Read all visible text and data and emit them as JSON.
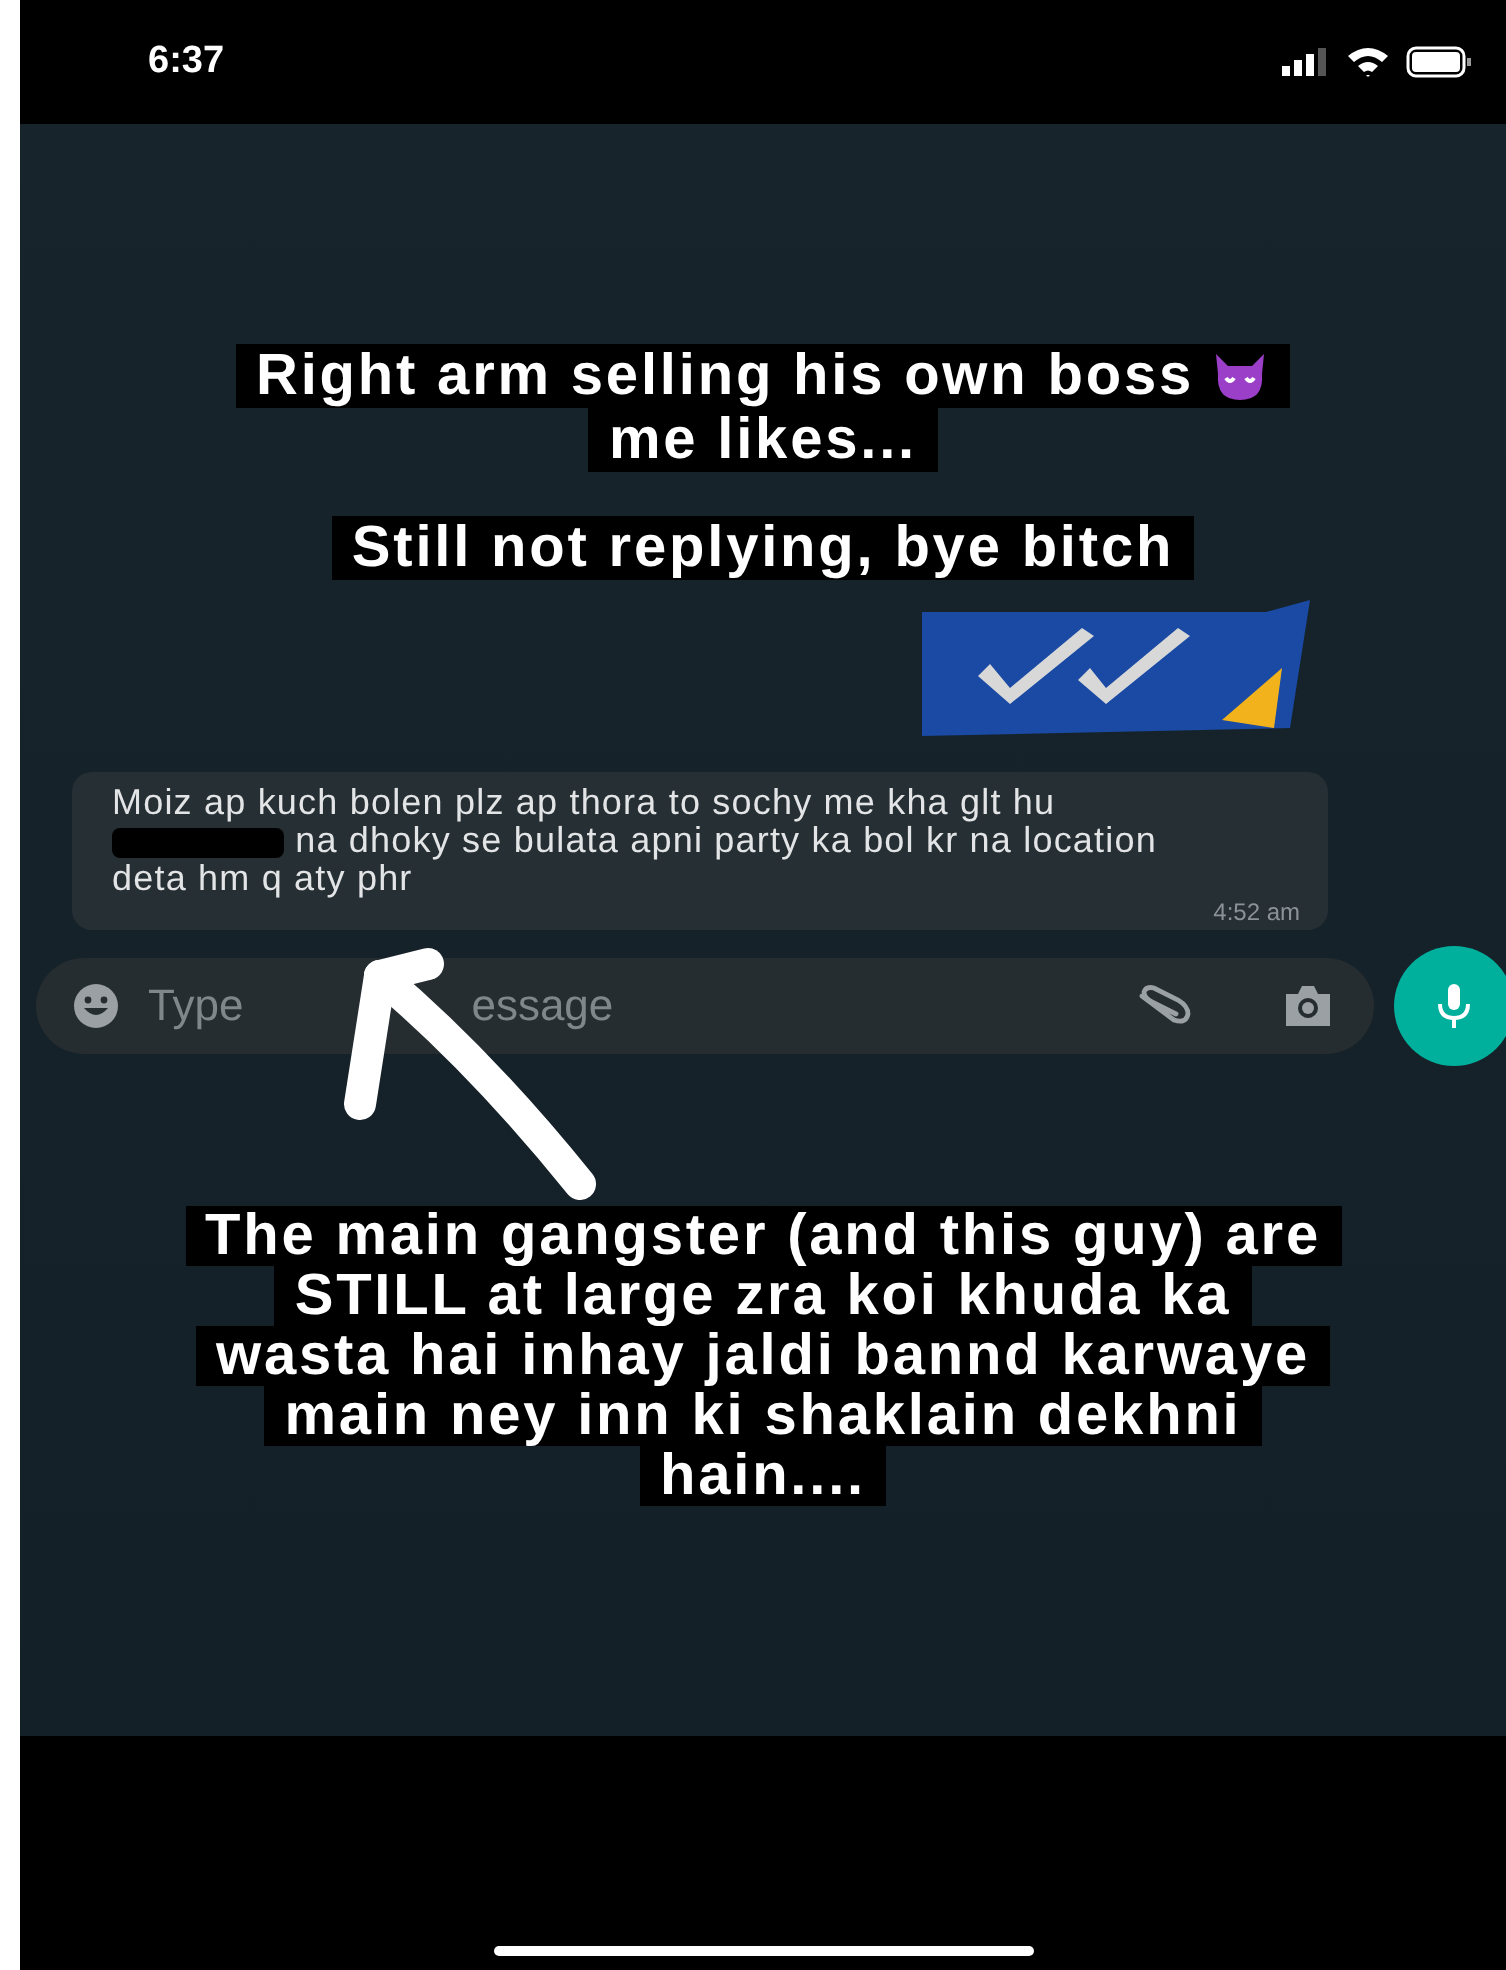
{
  "status_bar": {
    "time": "6:37"
  },
  "captions_top": [
    {
      "text": "Right arm selling his own boss",
      "kind": "with_devil_emoji"
    },
    {
      "text": "me likes...",
      "kind": "plain"
    },
    {
      "text": "Still not replying, bye bitch",
      "kind": "plain"
    }
  ],
  "message": {
    "text_before": "Moiz ap kuch bolen plz ap thora to sochy me kha glt hu",
    "redacted": true,
    "text_after": "na dhoky se bulata apni party ka bol kr na location deta hm q aty phr",
    "time": "4:52 am"
  },
  "composer": {
    "placeholder_start": "Type",
    "placeholder_end": "essage"
  },
  "caption_bottom": [
    "The main gangster (and this guy) are",
    "STILL at large zra koi khuda ka",
    "wasta hai inhay jaldi bannd karwaye",
    "main ney inn ki shaklain dekhni",
    "hain...."
  ]
}
